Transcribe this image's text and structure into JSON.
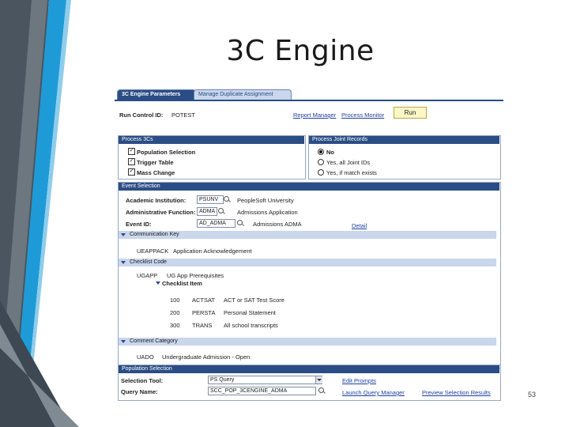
{
  "slide": {
    "title": "3C Engine",
    "page_number": "53"
  },
  "theme": {
    "accent_dark": "#2b4d85",
    "accent_light": "#c9d6ec",
    "deco_blue": "#1e9bd7",
    "deco_gray": "#5f6a72"
  },
  "tabs": {
    "active": "3C Engine Parameters",
    "inactive": "Manage Duplicate Assignment"
  },
  "run_control": {
    "label": "Run Control ID:",
    "value": "POTEST",
    "report_manager": "Report Manager",
    "process_monitor": "Process Monitor",
    "run_button": "Run"
  },
  "process_3cs": {
    "header": "Process 3Cs",
    "items": [
      "Population Selection",
      "Trigger Table",
      "Mass Change"
    ]
  },
  "joint_records": {
    "header": "Process Joint Records",
    "options": [
      "No",
      "Yes, all Joint IDs",
      "Yes, if match exists"
    ]
  },
  "event_selection": {
    "header": "Event Selection",
    "institution_label": "Academic Institution:",
    "institution_value": "PSUNV",
    "institution_desc": "PeopleSoft University",
    "function_label": "Administrative Function:",
    "function_value": "ADMA",
    "function_desc": "Admissions Application",
    "event_label": "Event ID:",
    "event_value": "AD_ADMA",
    "event_desc": "Admissions ADMA",
    "detail_link": "Detail"
  },
  "communication_key": {
    "header": "Communication Key",
    "value": "UEAPPACK",
    "desc": "Application Acknowledgement"
  },
  "checklist_code": {
    "header": "Checklist Code",
    "value": "UGAPP",
    "desc": "UG App Prerequisites",
    "item_header": "Checklist Item",
    "items": [
      {
        "seq": "100",
        "code": "ACTSAT",
        "desc": "ACT or SAT Test Score"
      },
      {
        "seq": "200",
        "code": "PERSTA",
        "desc": "Personal Statement"
      },
      {
        "seq": "300",
        "code": "TRANS",
        "desc": "All school transcripts"
      }
    ]
  },
  "comment_category": {
    "header": "Comment Category",
    "value": "UADO",
    "desc": "Undergraduate Admission - Open"
  },
  "population_selection": {
    "header": "Population Selection",
    "tool_label": "Selection Tool:",
    "tool_value": "PS Query",
    "query_label": "Query Name:",
    "query_value": "SCC_POP_3CENGINE_ADMA",
    "edit_prompts": "Edit Prompts",
    "launch_query_manager": "Launch Query Manager",
    "preview_results": "Preview Selection Results"
  }
}
